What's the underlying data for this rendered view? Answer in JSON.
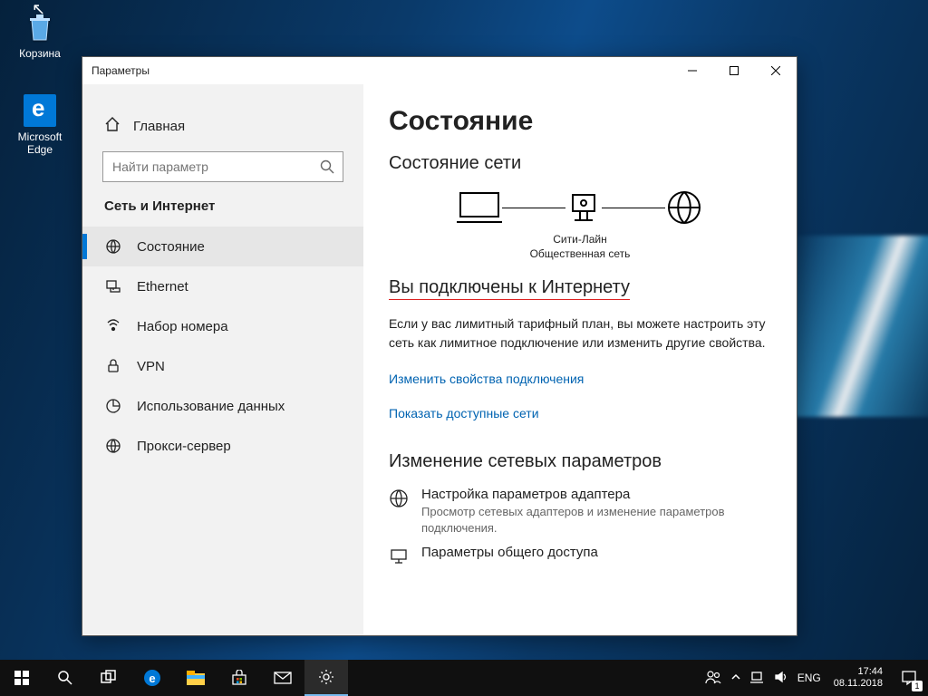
{
  "desktop": {
    "recycle_label": "Корзина",
    "edge_label": "Microsoft Edge"
  },
  "window": {
    "title": "Параметры",
    "home": "Главная",
    "search_placeholder": "Найти параметр",
    "section": "Сеть и Интернет",
    "nav": {
      "status": "Состояние",
      "ethernet": "Ethernet",
      "dialup": "Набор номера",
      "vpn": "VPN",
      "datausage": "Использование данных",
      "proxy": "Прокси-сервер"
    }
  },
  "content": {
    "h1": "Состояние",
    "h2a": "Состояние сети",
    "net_name": "Сити-Лайн",
    "net_type": "Общественная сеть",
    "connected": "Вы подключены к Интернету",
    "body": "Если у вас лимитный тарифный план, вы можете настроить эту сеть как лимитное подключение или изменить другие свойства.",
    "link1": "Изменить свойства подключения",
    "link2": "Показать доступные сети",
    "h2b": "Изменение сетевых параметров",
    "opt1_t": "Настройка параметров адаптера",
    "opt1_d": "Просмотр сетевых адаптеров и изменение параметров подключения.",
    "opt2_t": "Параметры общего доступа"
  },
  "taskbar": {
    "lang": "ENG",
    "time": "17:44",
    "date": "08.11.2018",
    "notif_count": "1"
  }
}
